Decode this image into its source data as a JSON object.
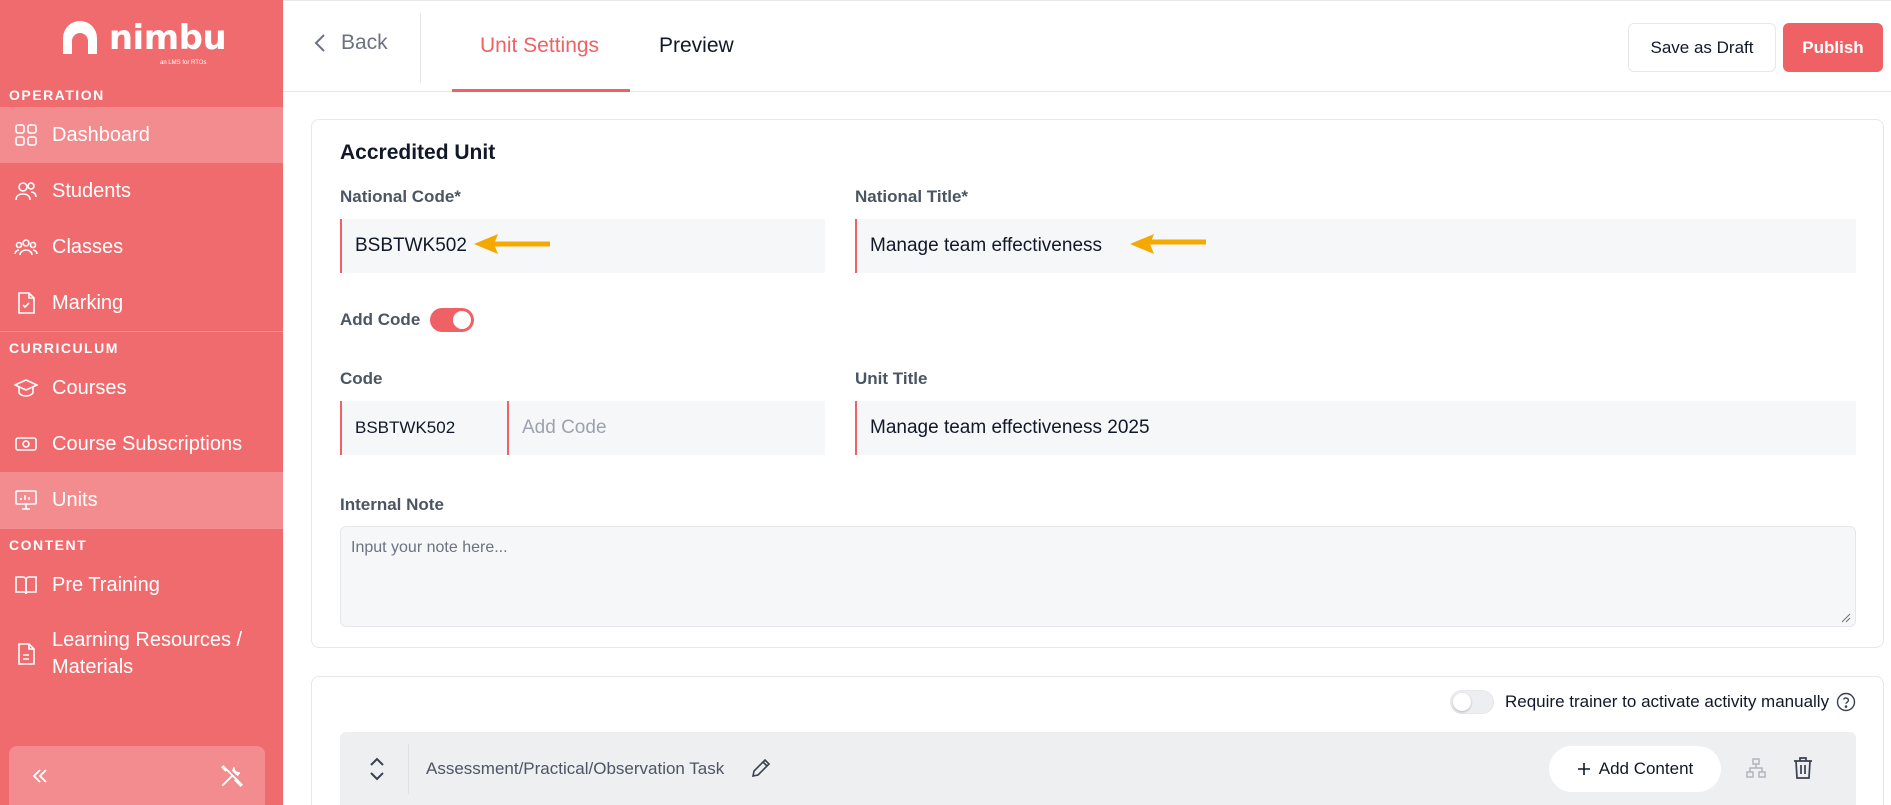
{
  "brand": {
    "name": "nimbu",
    "tagline": "an LMS for RTOs"
  },
  "sidebar": {
    "sections": {
      "operation": "OPERATION",
      "curriculum": "CURRICULUM",
      "content": "CONTENT"
    },
    "items": {
      "dashboard": "Dashboard",
      "students": "Students",
      "classes": "Classes",
      "marking": "Marking",
      "courses": "Courses",
      "subscriptions": "Course Subscriptions",
      "units": "Units",
      "pretraining": "Pre Training",
      "resources_1": "Learning Resources /",
      "resources_2": "Materials"
    }
  },
  "topbar": {
    "back_label": "Back",
    "tabs": {
      "unit_settings": "Unit Settings",
      "preview": "Preview"
    },
    "save_draft_label": "Save as Draft",
    "publish_label": "Publish"
  },
  "unit": {
    "title": "Accredited Unit",
    "national_code_label": "National Code*",
    "national_code_value": "BSBTWK502",
    "national_title_label": "National Title*",
    "national_title_value": "Manage team effectiveness",
    "add_code_label": "Add Code",
    "add_code_enabled": true,
    "code_label": "Code",
    "code_prefix": "BSBTWK502",
    "code_placeholder": "Add Code",
    "unit_title_label": "Unit Title",
    "unit_title_value": "Manage team effectiveness 2025",
    "internal_note_label": "Internal Note",
    "internal_note_placeholder": "Input your note here..."
  },
  "activities": {
    "require_trainer_label": "Require trainer to activate activity manually",
    "require_trainer_enabled": false,
    "task_title": "Assessment/Practical/Observation Task",
    "add_content_label": "Add Content"
  },
  "colors": {
    "brand": "#f06b6e",
    "accent": "#ef6165",
    "arrow": "#f5a800"
  }
}
